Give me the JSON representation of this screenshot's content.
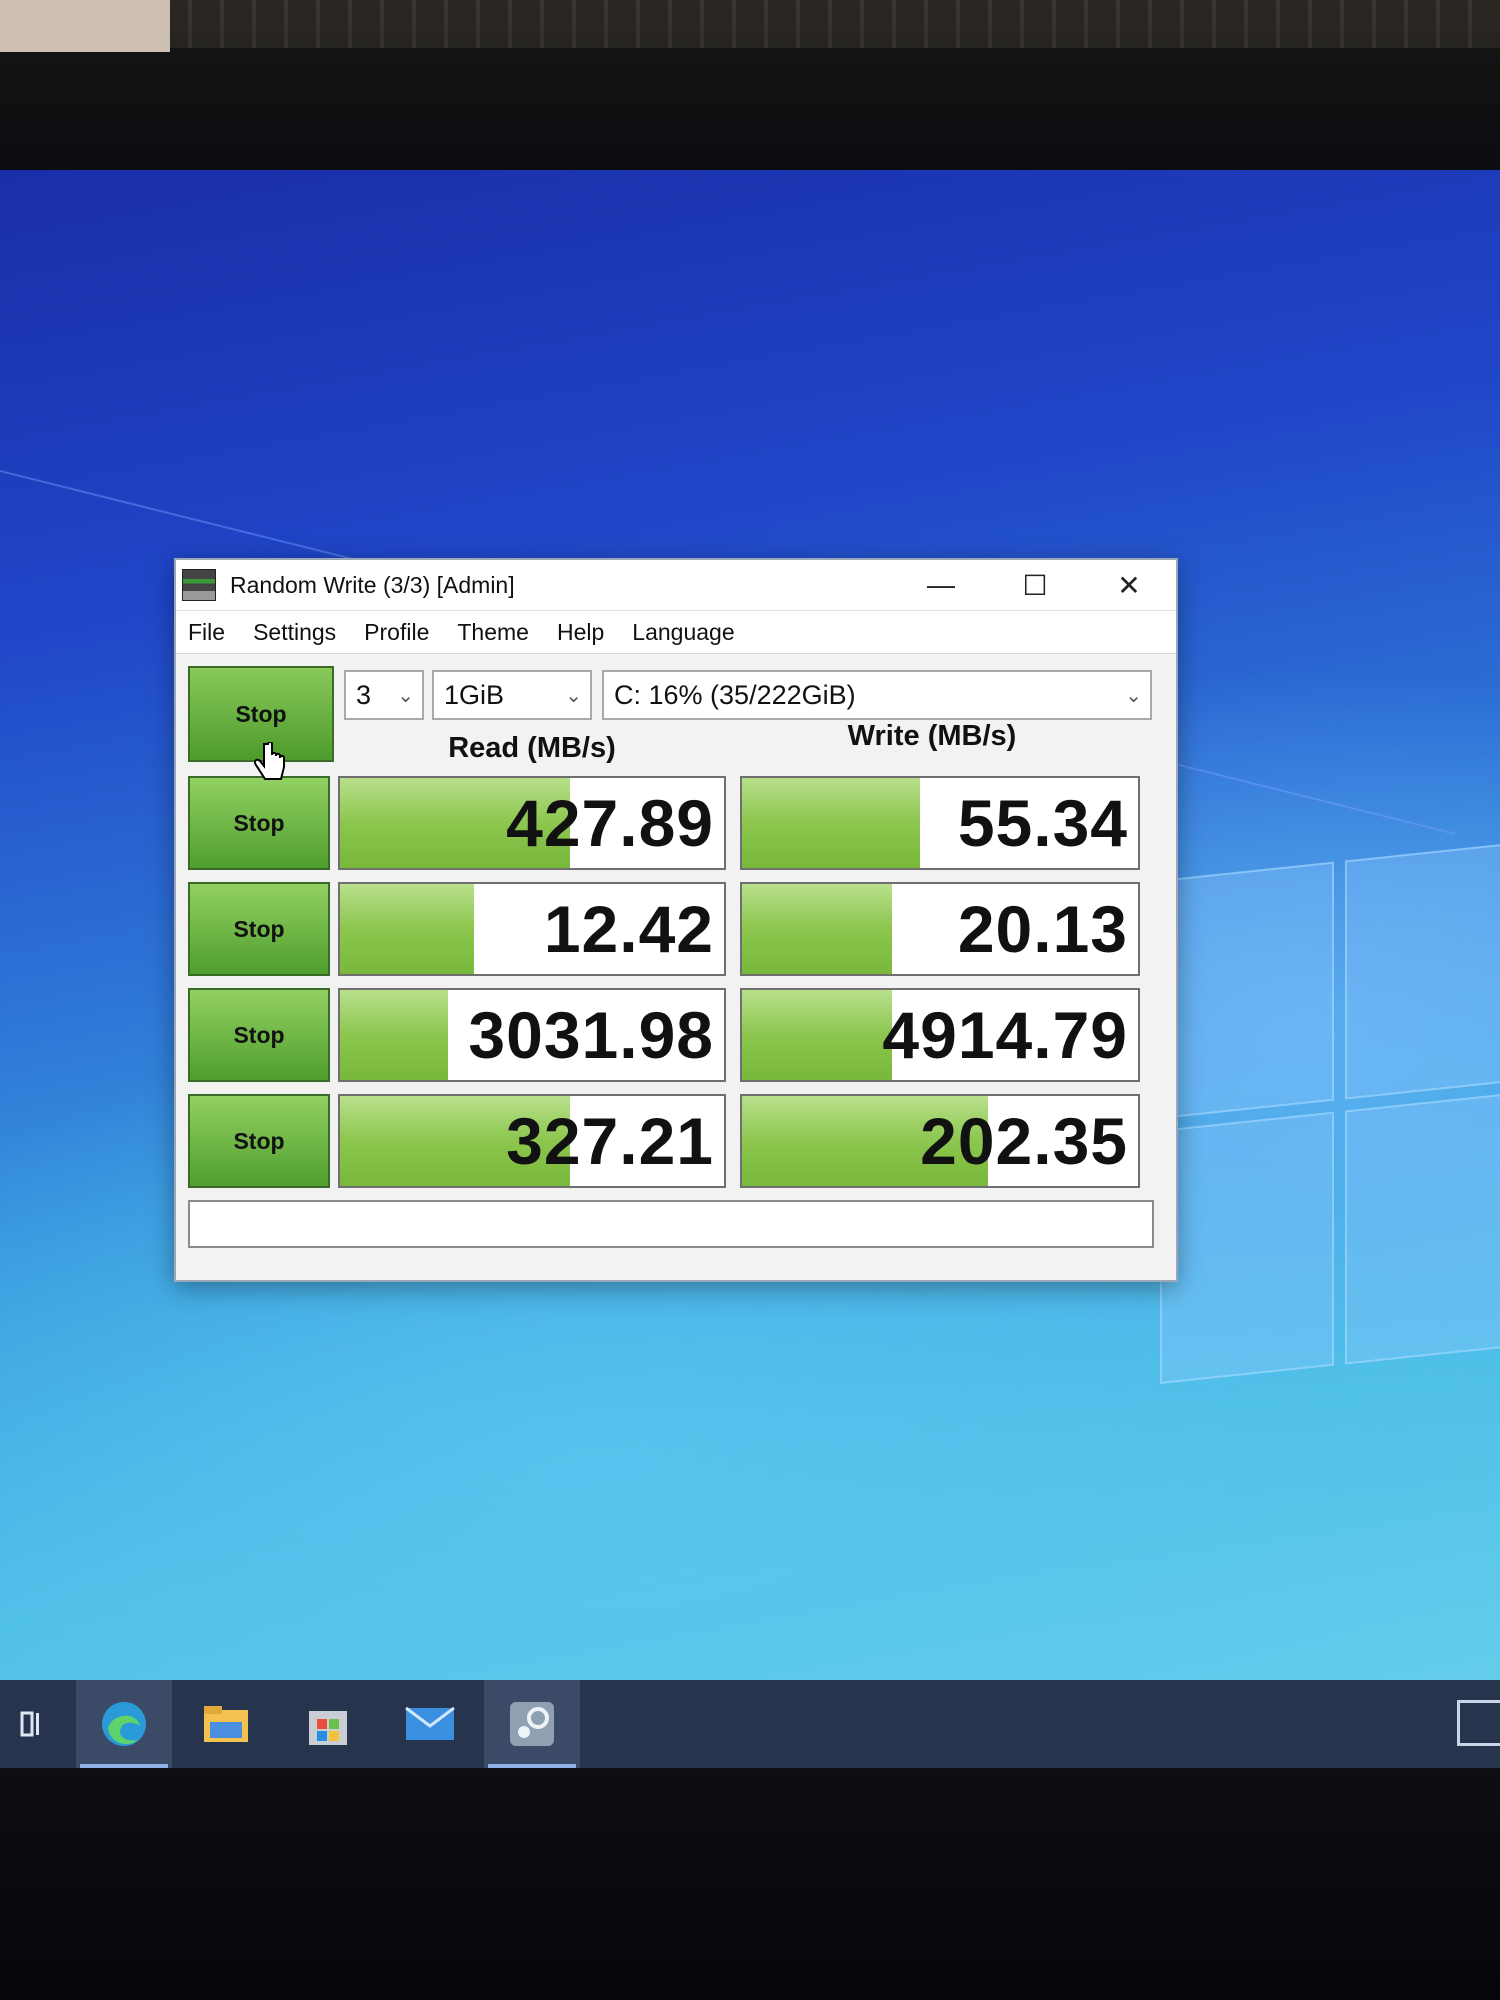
{
  "window": {
    "title": "Random Write (3/3) [Admin]",
    "controls": {
      "minimize": "—",
      "maximize": "☐",
      "close": "✕"
    }
  },
  "menu": [
    "File",
    "Settings",
    "Profile",
    "Theme",
    "Help",
    "Language"
  ],
  "toolbar": {
    "all_button_label": "Stop",
    "count_value": "3",
    "size_value": "1GiB",
    "drive_value": "C: 16% (35/222GiB)"
  },
  "headers": {
    "read": "Read (MB/s)",
    "write": "Write (MB/s)"
  },
  "rows": [
    {
      "button": "Stop",
      "read": "427.89",
      "write": "55.34",
      "read_fill": 0.6,
      "write_fill": 0.45
    },
    {
      "button": "Stop",
      "read": "12.42",
      "write": "20.13",
      "read_fill": 0.35,
      "write_fill": 0.38
    },
    {
      "button": "Stop",
      "read": "3031.98",
      "write": "4914.79",
      "read_fill": 0.28,
      "write_fill": 0.38
    },
    {
      "button": "Stop",
      "read": "327.21",
      "write": "202.35",
      "read_fill": 0.6,
      "write_fill": 0.62
    }
  ],
  "taskbar": {
    "icons": [
      "task-view-icon",
      "edge-icon",
      "file-explorer-icon",
      "store-icon",
      "mail-icon",
      "steam-icon"
    ],
    "colors": {
      "edge": "#2b9bd8",
      "explorer": "#f2c14e",
      "store": "#9aa0a6",
      "mail": "#3a8fe0",
      "steam": "#c8d0d8"
    }
  }
}
